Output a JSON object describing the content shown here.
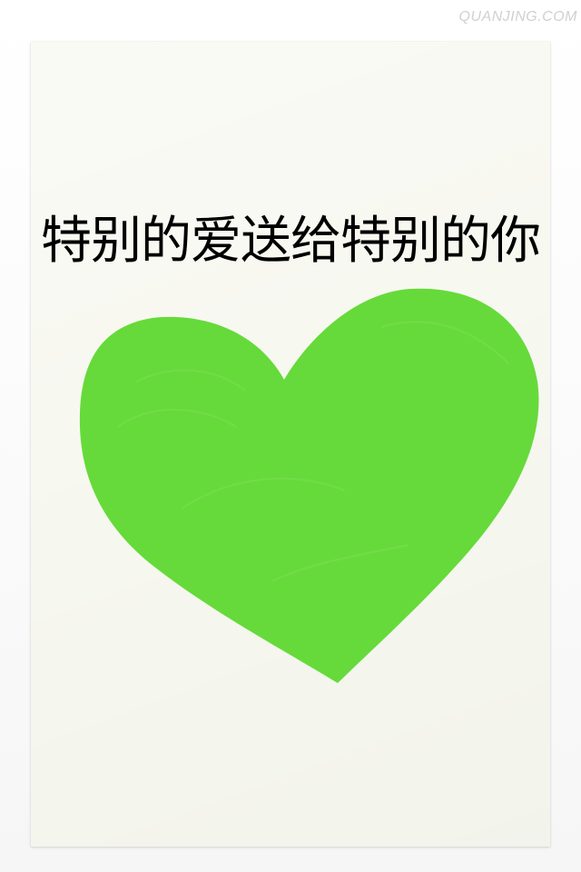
{
  "watermark": {
    "text": "QUANJING.COM"
  },
  "card": {
    "headline": "特别的爱送给特别的你"
  },
  "colors": {
    "heart_fill": "#66da3a",
    "card_paper": "#f7f8f0",
    "headline_text": "#000000"
  }
}
